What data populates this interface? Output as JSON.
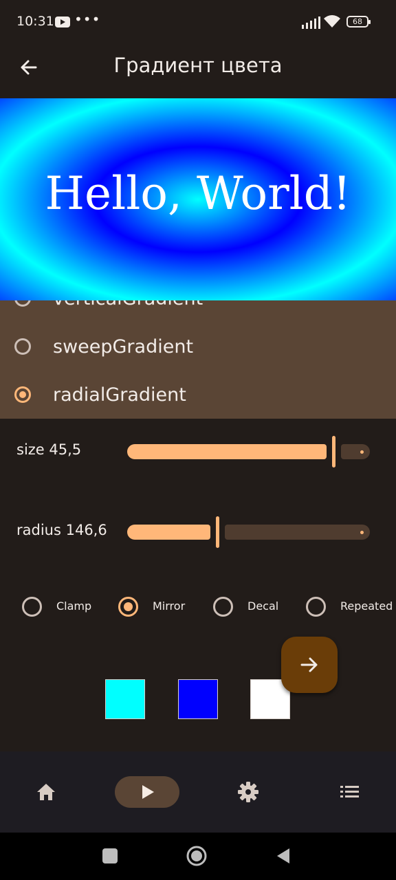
{
  "status_bar": {
    "time": "10:31",
    "battery": "68"
  },
  "app_bar": {
    "title": "Градиент цвета"
  },
  "preview": {
    "text": "Hello, World!"
  },
  "gradient_options": [
    {
      "label": "verticalGradient",
      "selected": false
    },
    {
      "label": "sweepGradient",
      "selected": false
    },
    {
      "label": "radialGradient",
      "selected": true
    }
  ],
  "sliders": {
    "size": {
      "label": "size 45,5",
      "fraction": 0.85
    },
    "radius": {
      "label": "radius 146,6",
      "fraction": 0.37
    }
  },
  "tile_modes": [
    {
      "label": "Clamp",
      "selected": false
    },
    {
      "label": "Mirror",
      "selected": true
    },
    {
      "label": "Decal",
      "selected": false
    },
    {
      "label": "Repeated",
      "selected": false
    }
  ],
  "colors": {
    "swatches": [
      "#00ffff",
      "#0000ff",
      "#ffffff"
    ],
    "accent": "#ffb779",
    "surface": "#221c19",
    "options_bg": "#5a4535",
    "fab_bg": "#6a3d08"
  },
  "fab": {
    "icon": "arrow-forward-icon"
  },
  "bottom_nav": [
    {
      "icon": "home-icon",
      "selected": false
    },
    {
      "icon": "play-icon",
      "selected": true
    },
    {
      "icon": "settings-gear-icon",
      "selected": false
    },
    {
      "icon": "list-icon",
      "selected": false
    }
  ],
  "system_nav": [
    "recents-square-icon",
    "home-circle-icon",
    "back-triangle-icon"
  ]
}
